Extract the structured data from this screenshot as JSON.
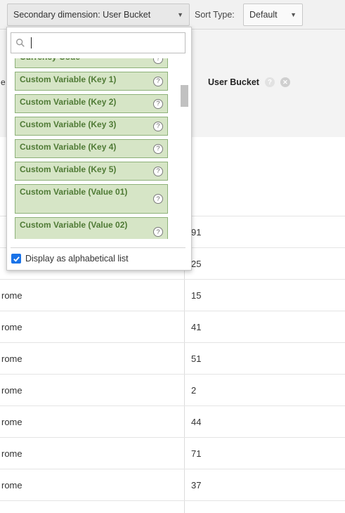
{
  "toolbar": {
    "secondary_dimension_label": "Secondary dimension: User Bucket",
    "sort_type_label": "Sort Type:",
    "sort_type_value": "Default"
  },
  "table": {
    "column_header": "User Bucket",
    "hidden_header_fragment": "e",
    "rows": [
      {
        "c1": "",
        "c2": "91"
      },
      {
        "c1": "",
        "c2": "25"
      },
      {
        "c1": "rome",
        "c2": "15"
      },
      {
        "c1": "rome",
        "c2": "41"
      },
      {
        "c1": "rome",
        "c2": "51"
      },
      {
        "c1": "rome",
        "c2": "2"
      },
      {
        "c1": "rome",
        "c2": "44"
      },
      {
        "c1": "rome",
        "c2": "71"
      },
      {
        "c1": "rome",
        "c2": "37"
      },
      {
        "c1": "",
        "c2": ""
      }
    ]
  },
  "dropdown": {
    "search_value": "",
    "items": [
      {
        "label": "Currency Code"
      },
      {
        "label": "Custom Variable (Key 1)"
      },
      {
        "label": "Custom Variable (Key 2)"
      },
      {
        "label": "Custom Variable (Key 3)"
      },
      {
        "label": "Custom Variable (Key 4)"
      },
      {
        "label": "Custom Variable (Key 5)"
      },
      {
        "label": "Custom Variable (Value 01)"
      },
      {
        "label": "Custom Variable (Value 02)"
      }
    ],
    "alphabetical_label": "Display as alphabetical list",
    "alphabetical_checked": true
  },
  "icons": {
    "search": "search-icon",
    "help": "help-icon",
    "remove": "remove-icon",
    "dropdown": "chevron-down-icon",
    "check": "check-icon"
  },
  "colors": {
    "item_bg": "#d6e5c6",
    "item_border": "#8db179",
    "item_text": "#4f7a35",
    "checkbox": "#1a73e8"
  }
}
